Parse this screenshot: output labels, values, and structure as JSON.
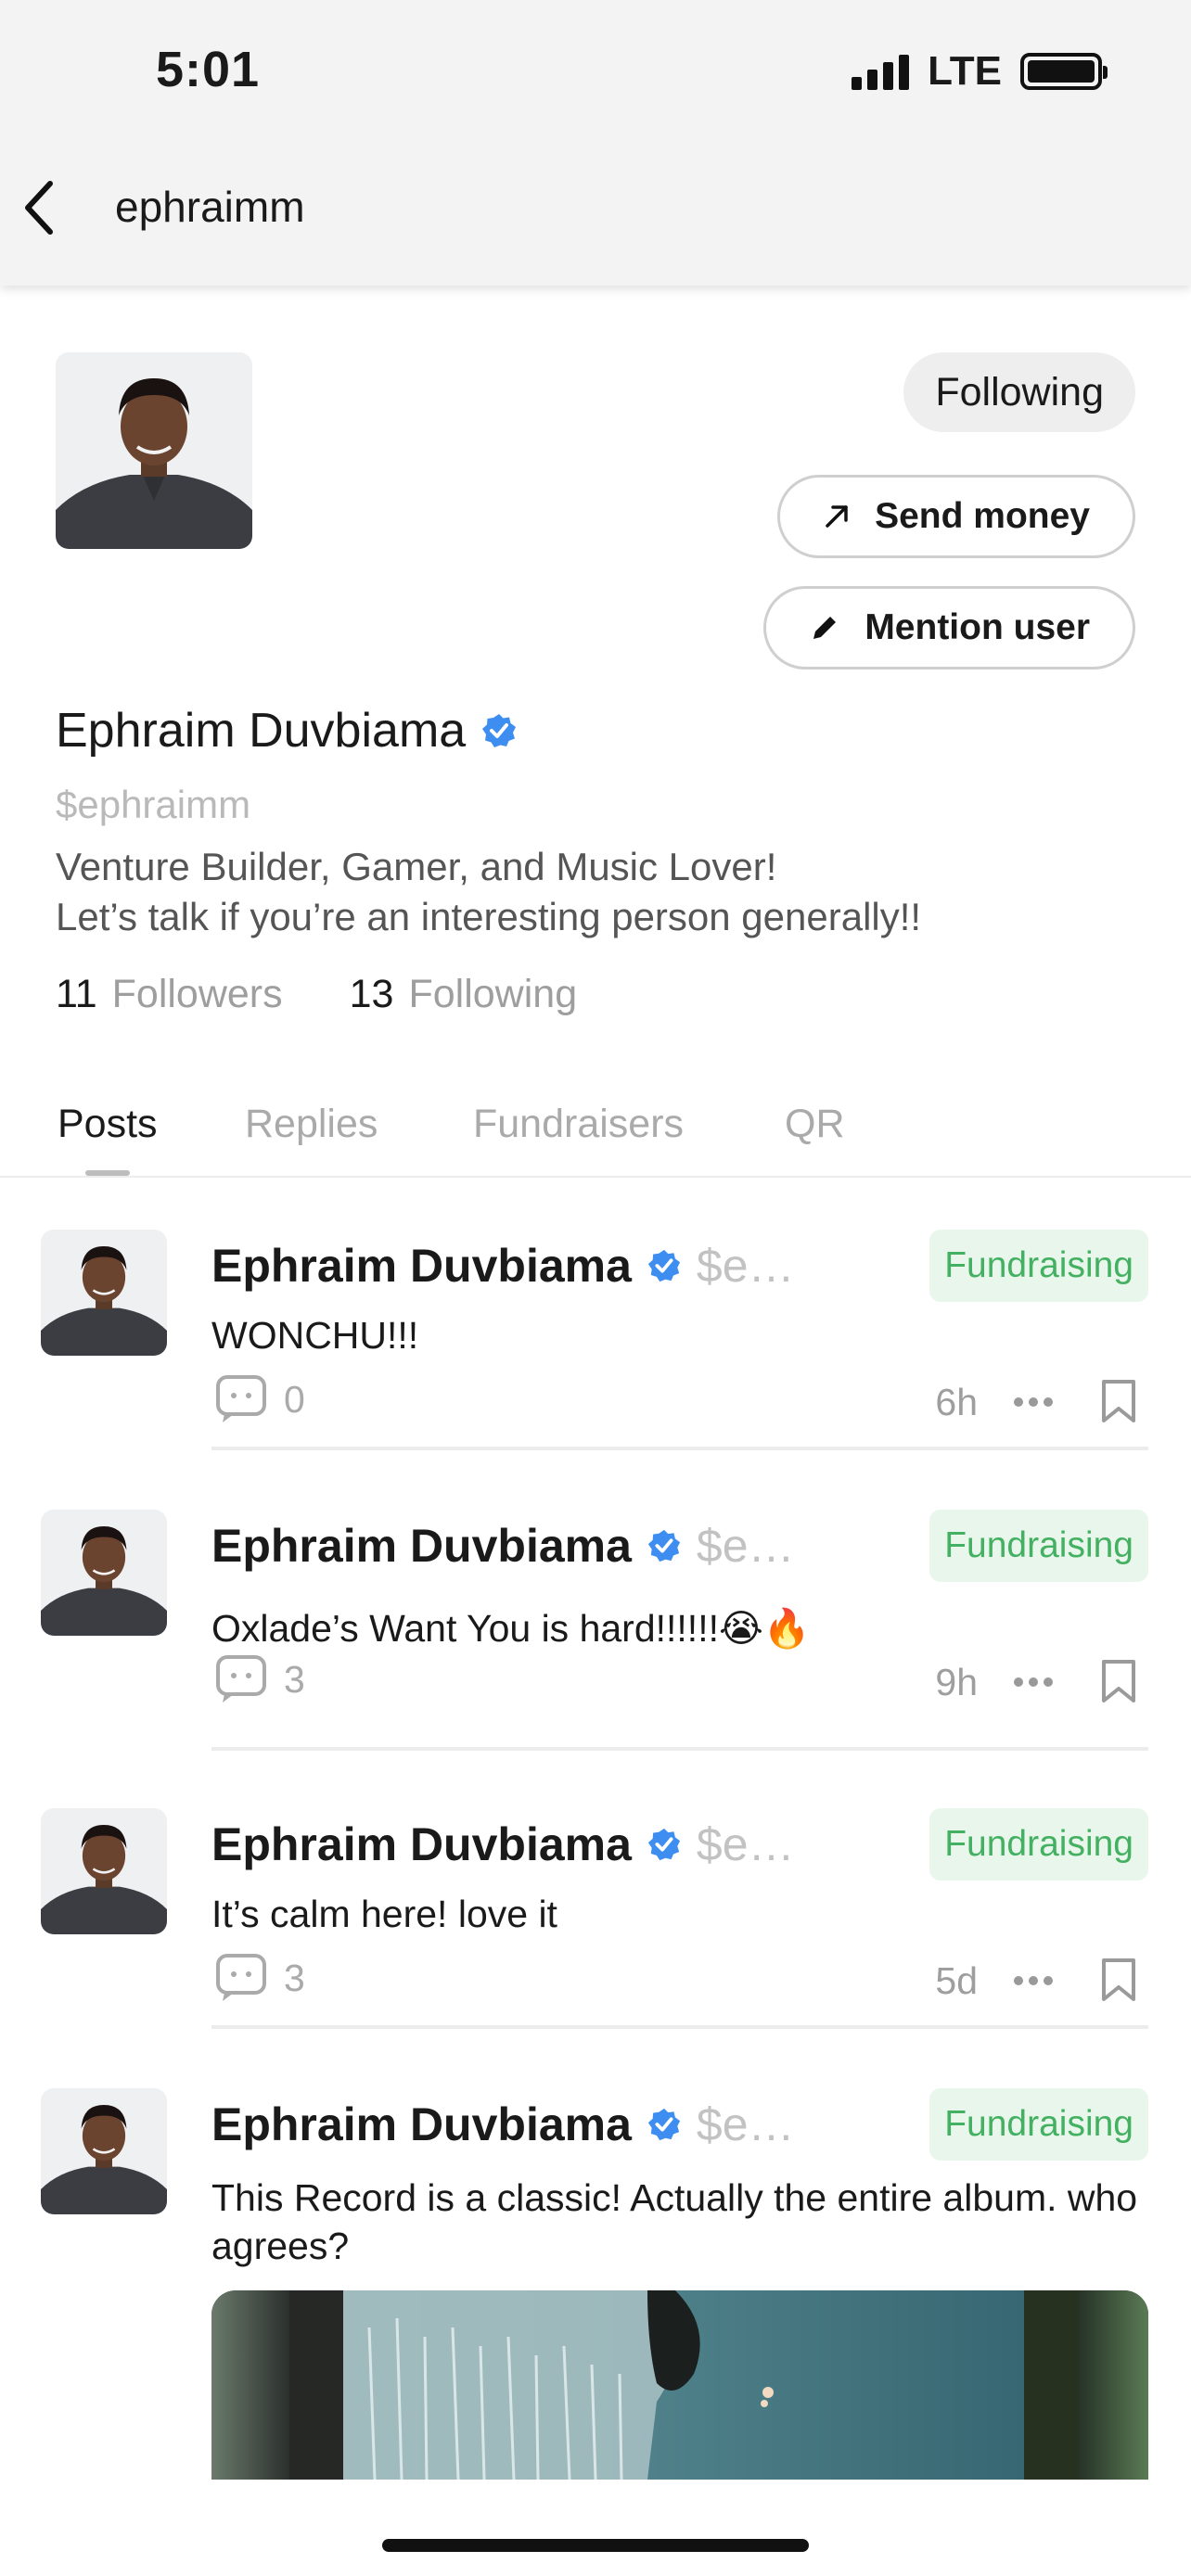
{
  "status_bar": {
    "time": "5:01",
    "network": "LTE"
  },
  "nav": {
    "title": "ephraimm"
  },
  "profile": {
    "name": "Ephraim Duvbiama",
    "handle": "$ephraimm",
    "bio_line1": "Venture Builder, Gamer, and Music Lover!",
    "bio_line2": "Let’s talk if you’re an interesting person generally!!",
    "followers_count": "11",
    "followers_label": "Followers",
    "following_count": "13",
    "following_label": "Following",
    "follow_button": "Following",
    "send_money_label": "Send money",
    "mention_label": "Mention user"
  },
  "tabs": [
    {
      "label": "Posts"
    },
    {
      "label": "Replies"
    },
    {
      "label": "Fundraisers"
    },
    {
      "label": "QR"
    }
  ],
  "posts": [
    {
      "author": "Ephraim Duvbiama",
      "handle": "$e…",
      "badge": "Fundraising",
      "text": "WONCHU!!!",
      "comments": "0",
      "age": "6h"
    },
    {
      "author": "Ephraim Duvbiama",
      "handle": "$e…",
      "badge": "Fundraising",
      "text": "Oxlade’s Want You is hard!!!!!!😭🔥",
      "comments": "3",
      "age": "9h"
    },
    {
      "author": "Ephraim Duvbiama",
      "handle": "$e…",
      "badge": "Fundraising",
      "text": "It’s calm here! love it",
      "comments": "3",
      "age": "5d"
    },
    {
      "author": "Ephraim Duvbiama",
      "handle": "$e…",
      "badge": "Fundraising",
      "text": "This Record is a classic! Actually the entire album. who agrees?"
    }
  ],
  "colors": {
    "verified": "#3d8ef0",
    "badge_bg": "#e8f6ec",
    "badge_text": "#44b061",
    "muted": "#aaaaaa"
  },
  "icons": [
    "back-chevron-icon",
    "signal-icon",
    "battery-icon",
    "arrow-up-right-icon",
    "pencil-icon",
    "verified-icon",
    "comment-icon",
    "more-icon",
    "bookmark-icon"
  ]
}
